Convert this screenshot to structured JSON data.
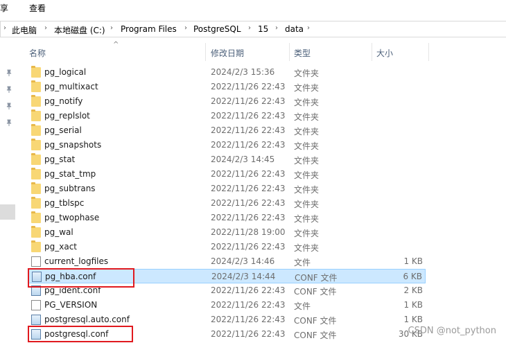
{
  "ribbon": {
    "tabs": [
      "享",
      "查看"
    ]
  },
  "address": {
    "crumbs": [
      "此电脑",
      "本地磁盘 (C:)",
      "Program Files",
      "PostgreSQL",
      "15",
      "data"
    ]
  },
  "columns": {
    "name": "名称",
    "modified": "修改日期",
    "type": "类型",
    "size": "大小"
  },
  "files": [
    {
      "name": "pg_logical",
      "modified": "2024/2/3 15:36",
      "type": "文件夹",
      "size": "",
      "icon": "folder-icon"
    },
    {
      "name": "pg_multixact",
      "modified": "2022/11/26 22:43",
      "type": "文件夹",
      "size": "",
      "icon": "folder-icon"
    },
    {
      "name": "pg_notify",
      "modified": "2022/11/26 22:43",
      "type": "文件夹",
      "size": "",
      "icon": "folder-icon"
    },
    {
      "name": "pg_replslot",
      "modified": "2022/11/26 22:43",
      "type": "文件夹",
      "size": "",
      "icon": "folder-icon"
    },
    {
      "name": "pg_serial",
      "modified": "2022/11/26 22:43",
      "type": "文件夹",
      "size": "",
      "icon": "folder-icon"
    },
    {
      "name": "pg_snapshots",
      "modified": "2022/11/26 22:43",
      "type": "文件夹",
      "size": "",
      "icon": "folder-icon"
    },
    {
      "name": "pg_stat",
      "modified": "2024/2/3 14:45",
      "type": "文件夹",
      "size": "",
      "icon": "folder-icon"
    },
    {
      "name": "pg_stat_tmp",
      "modified": "2022/11/26 22:43",
      "type": "文件夹",
      "size": "",
      "icon": "folder-icon"
    },
    {
      "name": "pg_subtrans",
      "modified": "2022/11/26 22:43",
      "type": "文件夹",
      "size": "",
      "icon": "folder-icon"
    },
    {
      "name": "pg_tblspc",
      "modified": "2022/11/26 22:43",
      "type": "文件夹",
      "size": "",
      "icon": "folder-icon"
    },
    {
      "name": "pg_twophase",
      "modified": "2022/11/26 22:43",
      "type": "文件夹",
      "size": "",
      "icon": "folder-icon"
    },
    {
      "name": "pg_wal",
      "modified": "2022/11/28 19:00",
      "type": "文件夹",
      "size": "",
      "icon": "folder-icon"
    },
    {
      "name": "pg_xact",
      "modified": "2022/11/26 22:43",
      "type": "文件夹",
      "size": "",
      "icon": "folder-icon"
    },
    {
      "name": "current_logfiles",
      "modified": "2024/2/3 14:46",
      "type": "文件",
      "size": "1 KB",
      "icon": "file-icon"
    },
    {
      "name": "pg_hba.conf",
      "modified": "2024/2/3 14:44",
      "type": "CONF 文件",
      "size": "6 KB",
      "icon": "conf-file-icon",
      "selected": true
    },
    {
      "name": "pg_ident.conf",
      "modified": "2022/11/26 22:43",
      "type": "CONF 文件",
      "size": "2 KB",
      "icon": "conf-file-icon"
    },
    {
      "name": "PG_VERSION",
      "modified": "2022/11/26 22:43",
      "type": "文件",
      "size": "1 KB",
      "icon": "file-icon"
    },
    {
      "name": "postgresql.auto.conf",
      "modified": "2022/11/26 22:43",
      "type": "CONF 文件",
      "size": "1 KB",
      "icon": "conf-file-icon"
    },
    {
      "name": "postgresql.conf",
      "modified": "2022/11/26 22:43",
      "type": "CONF 文件",
      "size": "30 KB",
      "icon": "conf-file-icon"
    }
  ],
  "watermark": "CSDN @not_python",
  "colors": {
    "selection": "#cce8ff",
    "highlight": "#e0191e",
    "folder": "#f8d775"
  }
}
